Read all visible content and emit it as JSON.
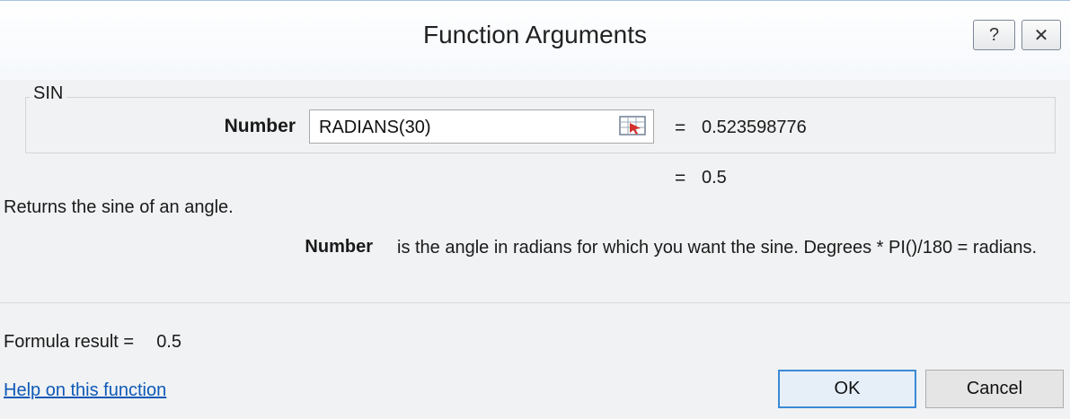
{
  "window": {
    "title": "Function Arguments",
    "help_glyph": "?",
    "close_glyph": "✕"
  },
  "function_group": {
    "name": "SIN",
    "argument": {
      "label": "Number",
      "value": "RADIANS(30)",
      "equals": "=",
      "evaluated": "0.523598776"
    }
  },
  "result_preview": {
    "equals": "=",
    "value": "0.5"
  },
  "description": "Returns the sine of an angle.",
  "argument_help": {
    "label": "Number",
    "text": "is the angle in radians for which you want the sine. Degrees * PI()/180 = radians."
  },
  "formula_result": {
    "label": "Formula result =",
    "value": "0.5"
  },
  "help_link": "Help on this function",
  "buttons": {
    "ok": "OK",
    "cancel": "Cancel"
  },
  "colors": {
    "link": "#0d59b7",
    "default_button_border": "#3a8ad6",
    "client_bg": "#f1f2f3"
  }
}
